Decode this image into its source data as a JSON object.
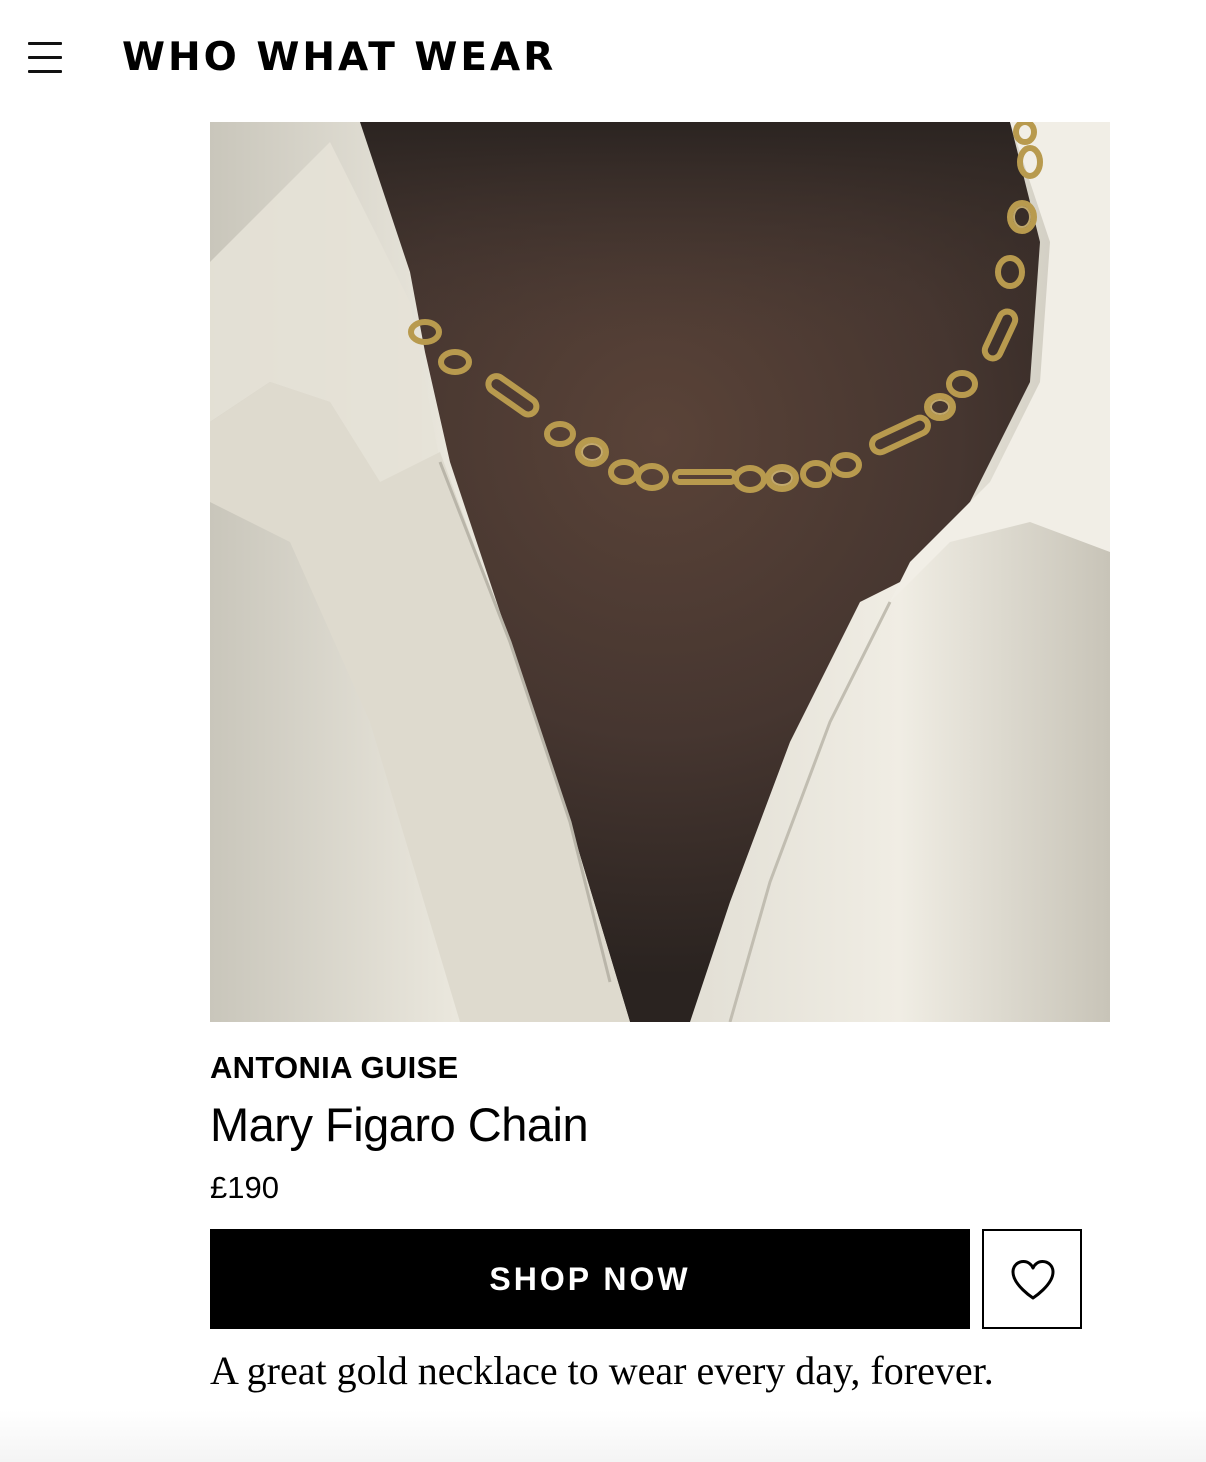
{
  "header": {
    "menu_icon": "hamburger-menu-icon",
    "logo_text": "WHO WHAT WEAR"
  },
  "product": {
    "image_alt": "Gold figaro chain necklace worn with a white open-collar shirt",
    "brand": "ANTONIA GUISE",
    "name": "Mary Figaro Chain",
    "price": "£190",
    "shop_label": "SHOP NOW",
    "favorite_icon": "heart-outline-icon",
    "description": "A great gold necklace to wear every day, forever."
  },
  "colors": {
    "text": "#000000",
    "button_bg": "#000000",
    "button_text": "#ffffff",
    "gold": "#b89a4e",
    "shirt": "#e9e6dc",
    "skin_shadow": "#3a302b"
  }
}
